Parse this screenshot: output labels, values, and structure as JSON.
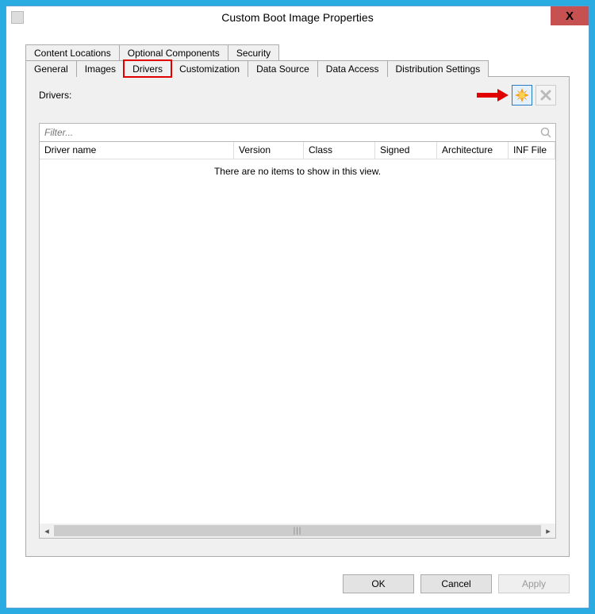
{
  "window": {
    "title": "Custom Boot Image Properties"
  },
  "tabs": {
    "row1": [
      {
        "id": "content-locations",
        "label": "Content Locations"
      },
      {
        "id": "optional-components",
        "label": "Optional Components"
      },
      {
        "id": "security",
        "label": "Security"
      }
    ],
    "row2": [
      {
        "id": "general",
        "label": "General"
      },
      {
        "id": "images",
        "label": "Images"
      },
      {
        "id": "drivers",
        "label": "Drivers",
        "selected": true,
        "highlighted": true
      },
      {
        "id": "customization",
        "label": "Customization"
      },
      {
        "id": "data-source",
        "label": "Data Source"
      },
      {
        "id": "data-access",
        "label": "Data Access"
      },
      {
        "id": "distribution-settings",
        "label": "Distribution Settings"
      }
    ]
  },
  "driversTab": {
    "label": "Drivers:",
    "filterPlaceholder": "Filter...",
    "columns": {
      "driver": "Driver name",
      "version": "Version",
      "class": "Class",
      "signed": "Signed",
      "architecture": "Architecture",
      "inf": "INF File"
    },
    "emptyMessage": "There are no items to show in this view."
  },
  "annotations": {
    "arrowColor": "#e00000"
  },
  "buttons": {
    "ok": "OK",
    "cancel": "Cancel",
    "apply": "Apply"
  }
}
